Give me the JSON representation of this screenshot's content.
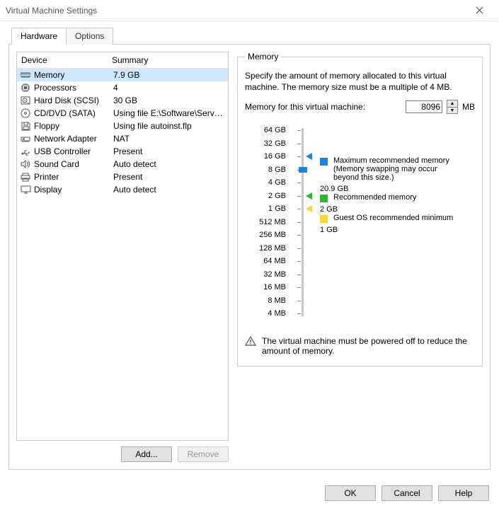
{
  "window": {
    "title": "Virtual Machine Settings"
  },
  "tabs": {
    "hardware": "Hardware",
    "options": "Options"
  },
  "list": {
    "header_device": "Device",
    "header_summary": "Summary",
    "rows": [
      {
        "icon": "memory-icon",
        "name": "Memory",
        "summary": "7.9 GB"
      },
      {
        "icon": "cpu-icon",
        "name": "Processors",
        "summary": "4"
      },
      {
        "icon": "hdd-icon",
        "name": "Hard Disk (SCSI)",
        "summary": "30 GB"
      },
      {
        "icon": "cd-icon",
        "name": "CD/DVD (SATA)",
        "summary": "Using file E:\\Software\\Serve..."
      },
      {
        "icon": "floppy-icon",
        "name": "Floppy",
        "summary": "Using file autoinst.flp"
      },
      {
        "icon": "net-icon",
        "name": "Network Adapter",
        "summary": "NAT"
      },
      {
        "icon": "usb-icon",
        "name": "USB Controller",
        "summary": "Present"
      },
      {
        "icon": "sound-icon",
        "name": "Sound Card",
        "summary": "Auto detect"
      },
      {
        "icon": "printer-icon",
        "name": "Printer",
        "summary": "Present"
      },
      {
        "icon": "display-icon",
        "name": "Display",
        "summary": "Auto detect"
      }
    ],
    "add_label": "Add...",
    "remove_label": "Remove"
  },
  "memory": {
    "legend": "Memory",
    "desc": "Specify the amount of memory allocated to this virtual machine. The memory size must be a multiple of 4 MB.",
    "input_label": "Memory for this virtual machine:",
    "value": "8096",
    "unit": "MB",
    "ticks": [
      "64 GB",
      "32 GB",
      "16 GB",
      "8 GB",
      "4 GB",
      "2 GB",
      "1 GB",
      "512 MB",
      "256 MB",
      "128 MB",
      "64 MB",
      "32 MB",
      "16 MB",
      "8 MB",
      "4 MB"
    ],
    "markers": {
      "max": {
        "color": "#1b84e0",
        "labelIndex": 2,
        "label": "Maximum recommended memory",
        "note": "(Memory swapping may occur beyond this size.)",
        "value": "20.9 GB"
      },
      "rec": {
        "color": "#2fb62f",
        "labelIndex": 5,
        "label": "Recommended memory",
        "value": "2 GB"
      },
      "min": {
        "color": "#f7d63e",
        "labelIndex": 6,
        "label": "Guest OS recommended minimum",
        "value": "1 GB"
      }
    },
    "thumbIndex": 3,
    "warning": "The virtual machine must be powered off to reduce the amount of memory."
  },
  "footer": {
    "ok": "OK",
    "cancel": "Cancel",
    "help": "Help"
  }
}
